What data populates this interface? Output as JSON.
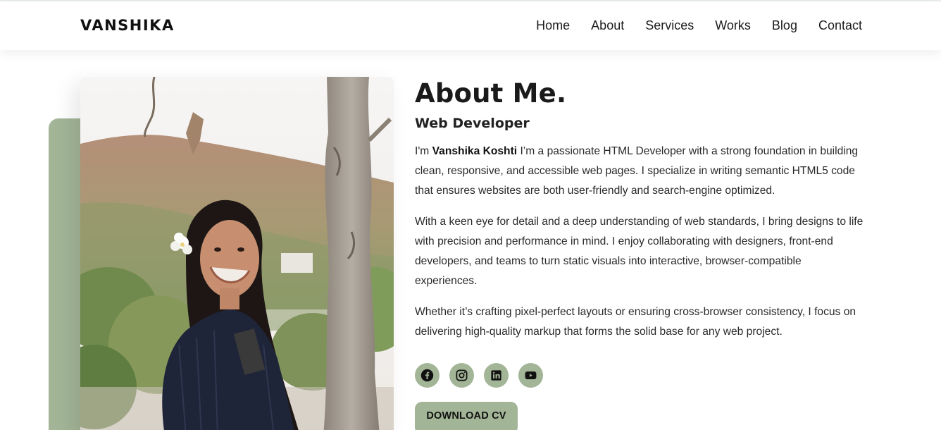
{
  "header": {
    "logo": "VANSHIKA",
    "nav": [
      "Home",
      "About",
      "Services",
      "Works",
      "Blog",
      "Contact"
    ]
  },
  "about": {
    "title": "About Me.",
    "subtitle": "Web Developer",
    "p1_prefix": "I'm ",
    "p1_name": "Vanshika Koshti",
    "p1_rest": " I’m a passionate HTML Developer with a strong foundation in building clean, responsive, and accessible web pages. I specialize in writing semantic HTML5 code that ensures websites are both user-friendly and search-engine optimized.",
    "p2": "With a keen eye for detail and a deep understanding of web standards, I bring designs to life with precision and performance in mind. I enjoy collaborating with designers, front-end developers, and teams to turn static visuals into interactive, browser-compatible experiences.",
    "p3": "Whether it’s crafting pixel-perfect layouts or ensuring cross-browser consistency, I focus on delivering high-quality markup that forms the solid base for any web project."
  },
  "socials": [
    {
      "icon": "facebook-icon"
    },
    {
      "icon": "instagram-icon"
    },
    {
      "icon": "linkedin-icon"
    },
    {
      "icon": "youtube-icon"
    }
  ],
  "download_label": "DOWNLOAD CV",
  "colors": {
    "accent": "#a3b597",
    "text": "#222222",
    "background": "#ffffff"
  }
}
